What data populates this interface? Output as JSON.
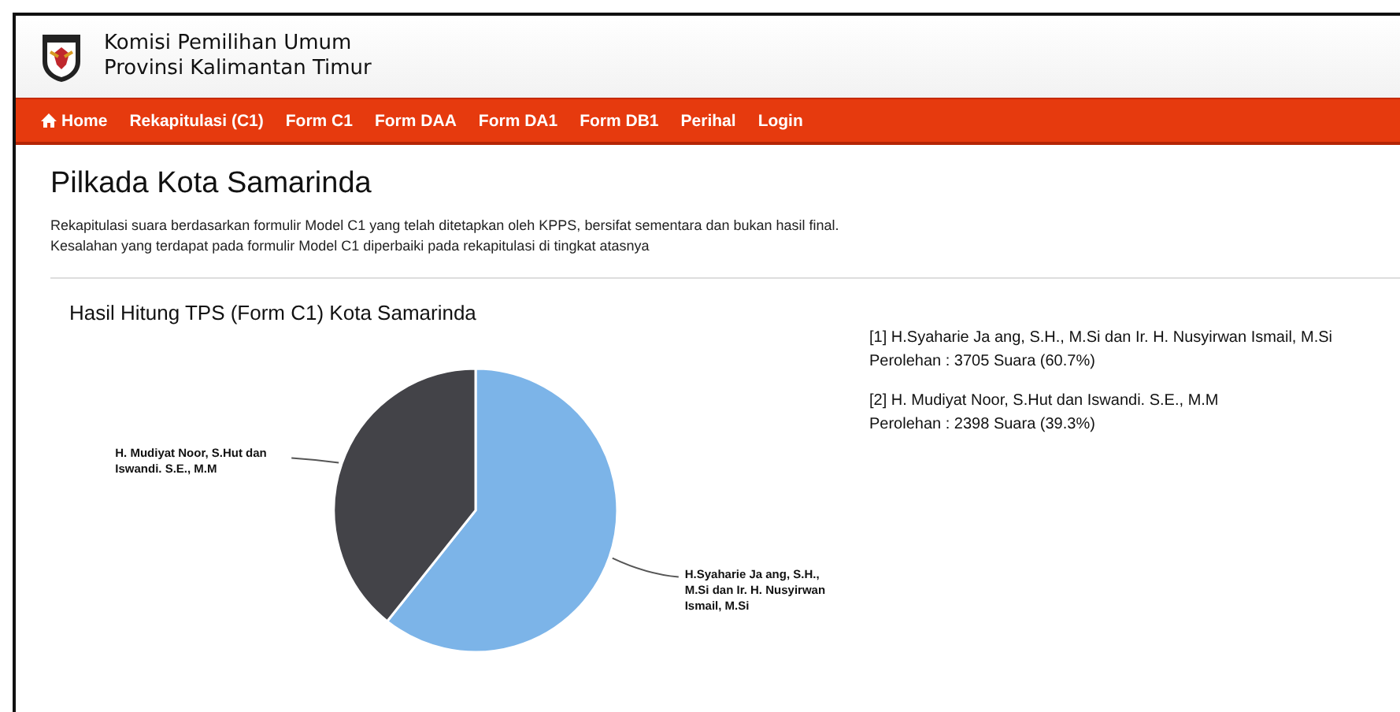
{
  "header": {
    "title_line_1": "Komisi Pemilihan Umum",
    "title_line_2": "Provinsi Kalimantan Timur"
  },
  "nav": [
    {
      "label": "Home",
      "kind": "home"
    },
    {
      "label": "Rekapitulasi (C1)",
      "kind": "text"
    },
    {
      "label": "Form C1",
      "kind": "text"
    },
    {
      "label": "Form DAA",
      "kind": "text"
    },
    {
      "label": "Form DA1",
      "kind": "text"
    },
    {
      "label": "Form DB1",
      "kind": "text"
    },
    {
      "label": "Perihal",
      "kind": "text"
    },
    {
      "label": "Login",
      "kind": "text"
    }
  ],
  "page": {
    "title": "Pilkada Kota Samarinda",
    "notes": [
      "Rekapitulasi suara berdasarkan formulir Model C1 yang telah ditetapkan oleh KPPS, bersifat sementara dan bukan hasil final.",
      "Kesalahan yang terdapat pada formulir Model C1 diperbaiki pada rekapitulasi di tingkat atasnya"
    ]
  },
  "chart_panel": {
    "title": "Hasil Hitung TPS (Form C1) Kota Samarinda",
    "chart_data": {
      "type": "pie",
      "categories": [
        "H.Syaharie Ja ang, S.H., M.Si dan Ir. H. Nusyirwan Ismail, M.Si",
        "H. Mudiyat Noor, S.Hut dan Iswandi. S.E., M.M"
      ],
      "values": [
        60.7,
        39.3
      ],
      "colors": [
        "#7cb4e8",
        "#434348"
      ]
    }
  },
  "results": [
    {
      "candidate": "[1] H.Syaharie Ja ang, S.H., M.Si dan Ir. H. Nusyirwan Ismail, M.Si",
      "votes": "Perolehan : 3705 Suara (60.7%)"
    },
    {
      "candidate": "[2] H. Mudiyat Noor, S.Hut dan Iswandi. S.E., M.M",
      "votes": "Perolehan : 2398 Suara (39.3%)"
    }
  ]
}
